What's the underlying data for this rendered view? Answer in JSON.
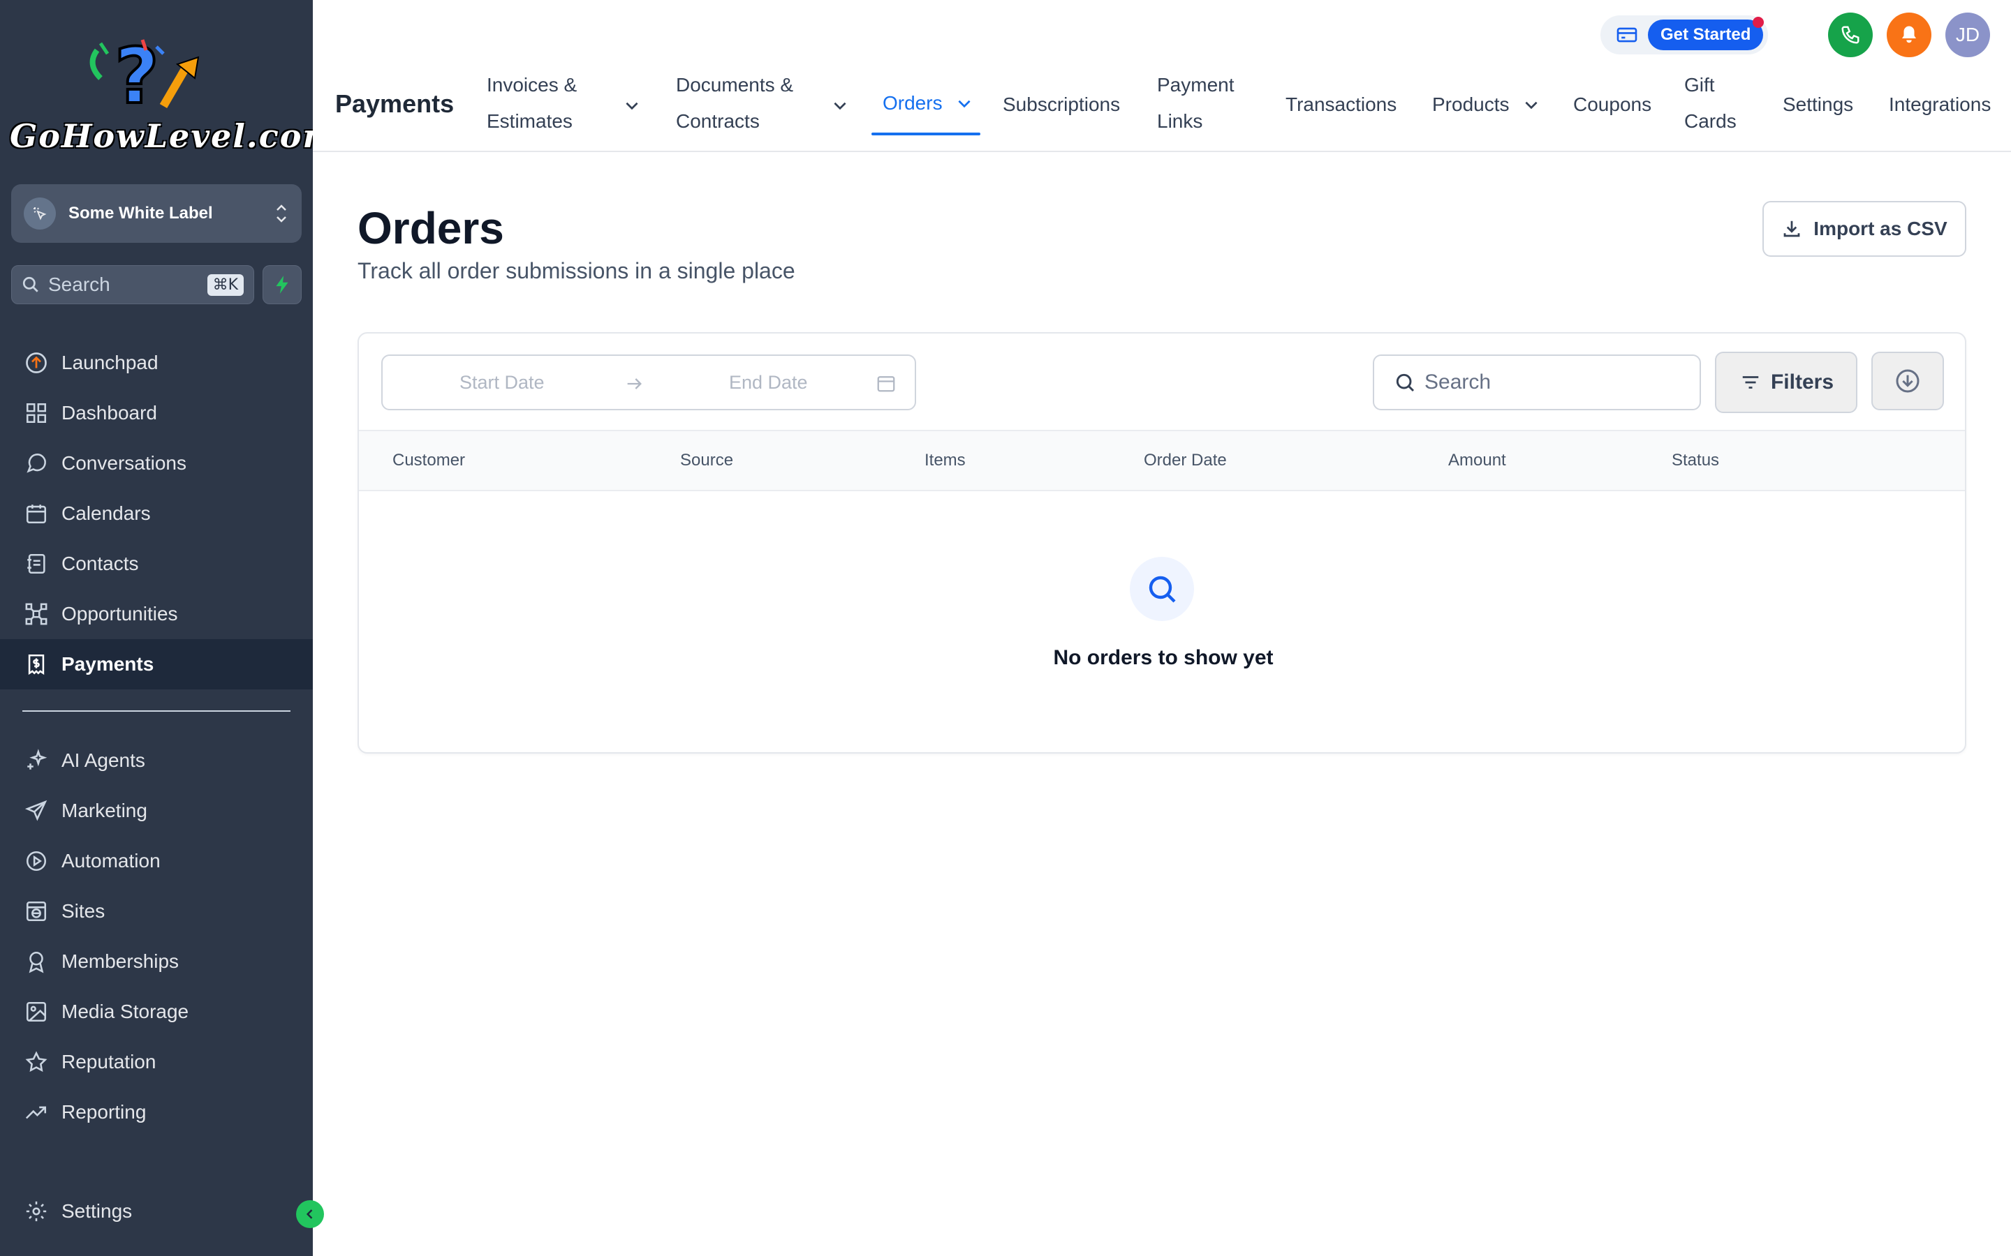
{
  "brand": {
    "logo_text": "GoHowLevel.com"
  },
  "sidebar": {
    "account_name": "Some White Label",
    "search_placeholder": "Search",
    "search_shortcut": "⌘K",
    "items": [
      {
        "label": "Launchpad",
        "icon": "launchpad-icon"
      },
      {
        "label": "Dashboard",
        "icon": "dashboard-icon"
      },
      {
        "label": "Conversations",
        "icon": "chat-bubble-icon"
      },
      {
        "label": "Calendars",
        "icon": "calendar-icon"
      },
      {
        "label": "Contacts",
        "icon": "contacts-book-icon"
      },
      {
        "label": "Opportunities",
        "icon": "network-icon"
      },
      {
        "label": "Payments",
        "icon": "receipt-dollar-icon",
        "active": true
      },
      {
        "label": "AI Agents",
        "icon": "sparkle-icon"
      },
      {
        "label": "Marketing",
        "icon": "paper-plane-icon"
      },
      {
        "label": "Automation",
        "icon": "play-circle-icon"
      },
      {
        "label": "Sites",
        "icon": "globe-window-icon"
      },
      {
        "label": "Memberships",
        "icon": "badge-icon"
      },
      {
        "label": "Media Storage",
        "icon": "image-icon"
      },
      {
        "label": "Reputation",
        "icon": "star-icon"
      },
      {
        "label": "Reporting",
        "icon": "trend-up-icon"
      }
    ],
    "settings_label": "Settings"
  },
  "topbar": {
    "get_started_label": "Get Started",
    "avatar_initials": "JD",
    "section_title": "Payments",
    "tabs": [
      {
        "line1": "Invoices &",
        "line2": "Estimates",
        "has_dropdown": true
      },
      {
        "line1": "Documents &",
        "line2": "Contracts",
        "has_dropdown": true
      },
      {
        "label": "Orders",
        "has_dropdown": true,
        "active": true
      },
      {
        "label": "Subscriptions"
      },
      {
        "line1": "Payment",
        "line2": "Links"
      },
      {
        "label": "Transactions"
      },
      {
        "label": "Products",
        "has_dropdown": true
      },
      {
        "label": "Coupons"
      },
      {
        "line1": "Gift",
        "line2": "Cards"
      },
      {
        "label": "Settings"
      },
      {
        "label": "Integrations"
      }
    ]
  },
  "main": {
    "title": "Orders",
    "subtitle": "Track all order submissions in a single place",
    "import_label": "Import as CSV",
    "date_range": {
      "start_placeholder": "Start Date",
      "end_placeholder": "End Date"
    },
    "search_placeholder": "Search",
    "filters_label": "Filters",
    "columns": [
      "Customer",
      "Source",
      "Items",
      "Order Date",
      "Amount",
      "Status"
    ],
    "empty_message": "No orders to show yet"
  },
  "colors": {
    "sidebar_bg": "#2d3748",
    "accent": "#1570ef",
    "phone": "#16a34a",
    "bell": "#f97316"
  }
}
